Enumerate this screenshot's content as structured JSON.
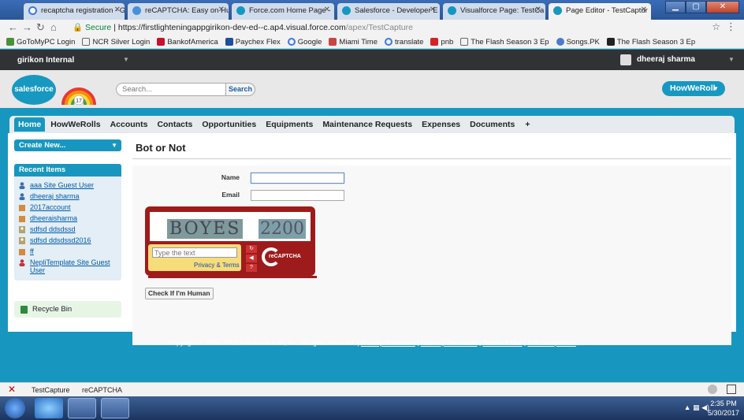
{
  "browser": {
    "tabs": [
      {
        "title": "recaptcha registration - G"
      },
      {
        "title": "reCAPTCHA: Easy on Hum"
      },
      {
        "title": "Force.com Home Page -"
      },
      {
        "title": "Salesforce - Developer E"
      },
      {
        "title": "Visualforce Page: TestCa"
      },
      {
        "title": "Page Editor - TestCaptur"
      }
    ],
    "address": {
      "secure_label": "Secure",
      "host": "https://firstlighteningappgirikon-dev-ed--c.ap4.visual.force.com",
      "path": "/apex/TestCapture"
    },
    "bookmarks": [
      "GoToMyPC Login",
      "NCR Silver Login",
      "BankofAmerica",
      "Paychex Flex",
      "Google",
      "Miami Time",
      "translate",
      "pnb",
      "The Flash Season 3 Ep",
      "Songs.PK",
      "The Flash Season 3 Ep"
    ]
  },
  "sf": {
    "org_name": "girikon Internal",
    "user_name": "dheeraj sharma",
    "logo_text": "salesforce",
    "rainbow_badge": "17",
    "search_placeholder": "Search...",
    "search_button": "Search",
    "app_menu": "HowWeRoll",
    "nav_tabs": [
      "Home",
      "HowWeRolls",
      "Accounts",
      "Contacts",
      "Opportunities",
      "Equipments",
      "Maintenance Requests",
      "Expenses",
      "Documents"
    ],
    "plus_tab": "+",
    "create_new": "Create New...",
    "recent_title": "Recent Items",
    "recent_items": [
      {
        "label": "aaa Site Guest User",
        "type": "user"
      },
      {
        "label": "dheeraj sharma",
        "type": "user"
      },
      {
        "label": "2017account",
        "type": "account"
      },
      {
        "label": "dheeraisharma",
        "type": "account"
      },
      {
        "label": "sdfsd ddsdssd",
        "type": "contact"
      },
      {
        "label": "sdfsd ddsdssd2016",
        "type": "contact"
      },
      {
        "label": "ff",
        "type": "account"
      },
      {
        "label": "NepliTemplate Site Guest User",
        "type": "user"
      }
    ],
    "recycle_bin": "Recycle Bin"
  },
  "page": {
    "title": "Bot or Not",
    "name_label": "Name",
    "email_label": "Email",
    "name_value": "",
    "email_value": "",
    "captcha": {
      "word1": "BOYES",
      "word2": "2200",
      "input_placeholder": "Type the text",
      "privacy": "Privacy & Terms",
      "brand": "reCAPTCHA"
    },
    "check_button": "Check If I'm Human"
  },
  "footer": {
    "copyright": "Copyright © 2000-2017 salesforce.com, inc. All rights reserved. |",
    "links": [
      "Privacy Statement",
      "Security Statement",
      "Terms of Use",
      "508 Compliance"
    ]
  },
  "downloads": [
    "TestCapture",
    "reCAPTCHA"
  ],
  "clock": {
    "time": "2:35 PM",
    "date": "5/30/2017"
  }
}
